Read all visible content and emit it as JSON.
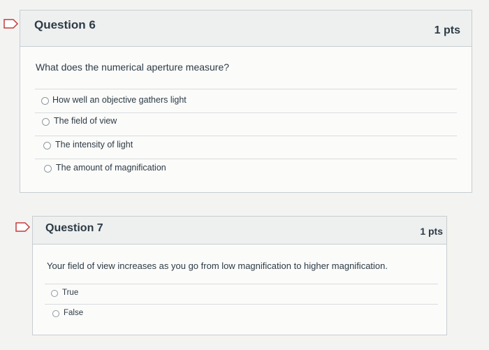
{
  "questions": [
    {
      "title": "Question 6",
      "points": "1 pts",
      "text": "What does the numerical aperture measure?",
      "answers": [
        "How well an objective gathers light",
        "The field of view",
        "The intensity of light",
        "The amount of magnification"
      ]
    },
    {
      "title": "Question 7",
      "points": "1 pts",
      "text": "Your field of view increases as you go from low magnification to higher magnification.",
      "answers": [
        "True",
        "False"
      ]
    }
  ],
  "colors": {
    "flag_border": "#c33c3c",
    "header_bg": "#eef0f0",
    "card_border": "#c7cdd1",
    "text": "#2d3b45"
  }
}
